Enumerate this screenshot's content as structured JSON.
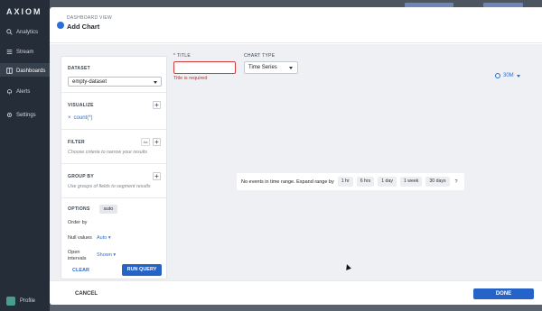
{
  "app": {
    "logo": "AXIOM",
    "nav": [
      {
        "label": "Analytics"
      },
      {
        "label": "Stream"
      },
      {
        "label": "Dashboards"
      },
      {
        "label": "Alerts"
      },
      {
        "label": "Settings"
      }
    ],
    "profile": "Profile"
  },
  "modal": {
    "subtitle": "DASHBOARD VIEW",
    "title": "Add Chart",
    "config": {
      "dataset_label": "DATASET",
      "dataset_value": "empty-dataset",
      "visualize_label": "VISUALIZE",
      "visualize_item": "count(*)",
      "filter_label": "FILTER",
      "filter_aa": "Aa",
      "filter_hint": "Choose criteria to narrow your results",
      "groupby_label": "GROUP BY",
      "groupby_hint": "Use groups of fields to segment results",
      "options_label": "OPTIONS",
      "order_by_label": "Order by",
      "order_by_value": "auto",
      "null_values_label": "Null values",
      "null_values_value": "Auto",
      "open_intervals_label_1": "Open",
      "open_intervals_label_2": "intervals",
      "open_intervals_value": "Shown",
      "clear": "CLEAR",
      "run_query": "RUN QUERY"
    },
    "chart": {
      "title_label": "* TITLE",
      "title_value": "",
      "title_error": "Title is required",
      "type_label": "CHART TYPE",
      "type_value": "Time Series",
      "time_range": "30M",
      "no_events_text": "No events in time range. Expand range by",
      "expand_options": [
        "1 hr",
        "6 hrs",
        "1 day",
        "1 week",
        "30 days"
      ],
      "help": "?"
    },
    "footer": {
      "cancel": "CANCEL",
      "done": "DONE"
    }
  }
}
